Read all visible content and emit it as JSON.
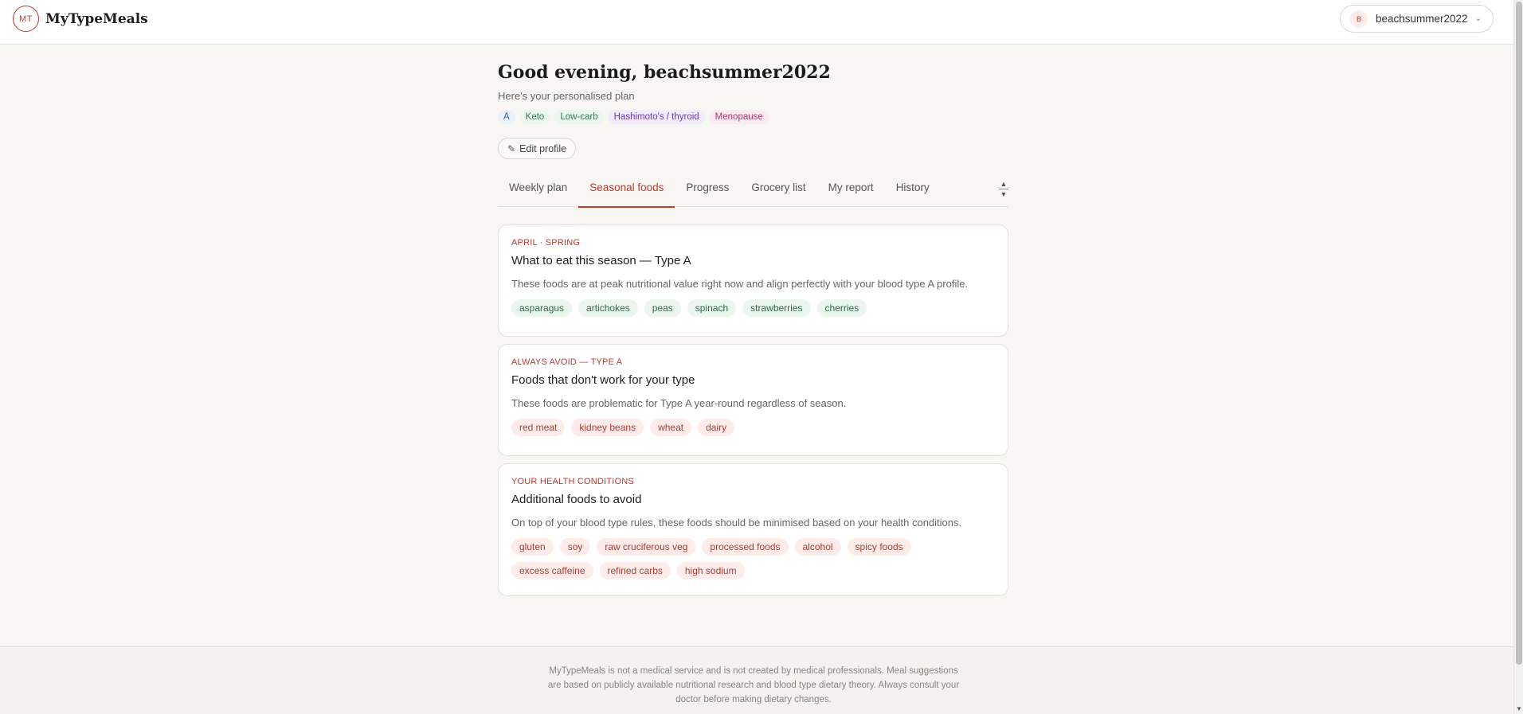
{
  "header": {
    "logo_mark": "MT",
    "app_name": "MyTypeMeals",
    "user": {
      "avatar_initial": "B",
      "name": "beachsummer2022",
      "chevron": "⌄"
    }
  },
  "main": {
    "greeting": "Good evening, beachsummer2022",
    "subtitle": "Here's your personalised plan",
    "tags": [
      {
        "label": "A"
      },
      {
        "label": "Keto"
      },
      {
        "label": "Low-carb"
      },
      {
        "label": "Hashimoto's / thyroid"
      },
      {
        "label": "Menopause"
      }
    ],
    "edit_profile_label": "Edit profile",
    "tabs": [
      {
        "label": "Weekly plan"
      },
      {
        "label": "Seasonal foods",
        "active": true
      },
      {
        "label": "Progress"
      },
      {
        "label": "Grocery list"
      },
      {
        "label": "My report"
      },
      {
        "label": "History"
      }
    ],
    "cards": [
      {
        "eyebrow": "APRIL · SPRING",
        "title": "What to eat this season — Type A",
        "description": "These foods are at peak nutritional value right now and align perfectly with your blood type A profile.",
        "chips": [
          "asparagus",
          "artichokes",
          "peas",
          "spinach",
          "strawberries",
          "cherries"
        ]
      },
      {
        "eyebrow": "ALWAYS AVOID — TYPE A",
        "title": "Foods that don't work for your type",
        "description": "These foods are problematic for Type A year-round regardless of season.",
        "chips": [
          "red meat",
          "kidney beans",
          "wheat",
          "dairy"
        ]
      },
      {
        "eyebrow": "YOUR HEALTH CONDITIONS",
        "title": "Additional foods to avoid",
        "description": "On top of your blood type rules, these foods should be minimised based on your health conditions.",
        "chips": [
          "gluten",
          "soy",
          "raw cruciferous veg",
          "processed foods",
          "alcohol",
          "spicy foods",
          "excess caffeine",
          "refined carbs",
          "high sodium"
        ]
      }
    ]
  },
  "footer": {
    "disclaimer": "MyTypeMeals is not a medical service and is not created by medical professionals. Meal suggestions are based on publicly available nutritional research and blood type dietary theory. Always consult your doctor before making dietary changes."
  },
  "colors": {
    "accent": "#c0392b",
    "background": "#f7f6f3",
    "good_chip": "#eaf6ee",
    "avoid_chip": "#fdecea"
  },
  "icons": {
    "edit": "pencil-icon",
    "user_menu": "chevron-down-icon"
  }
}
